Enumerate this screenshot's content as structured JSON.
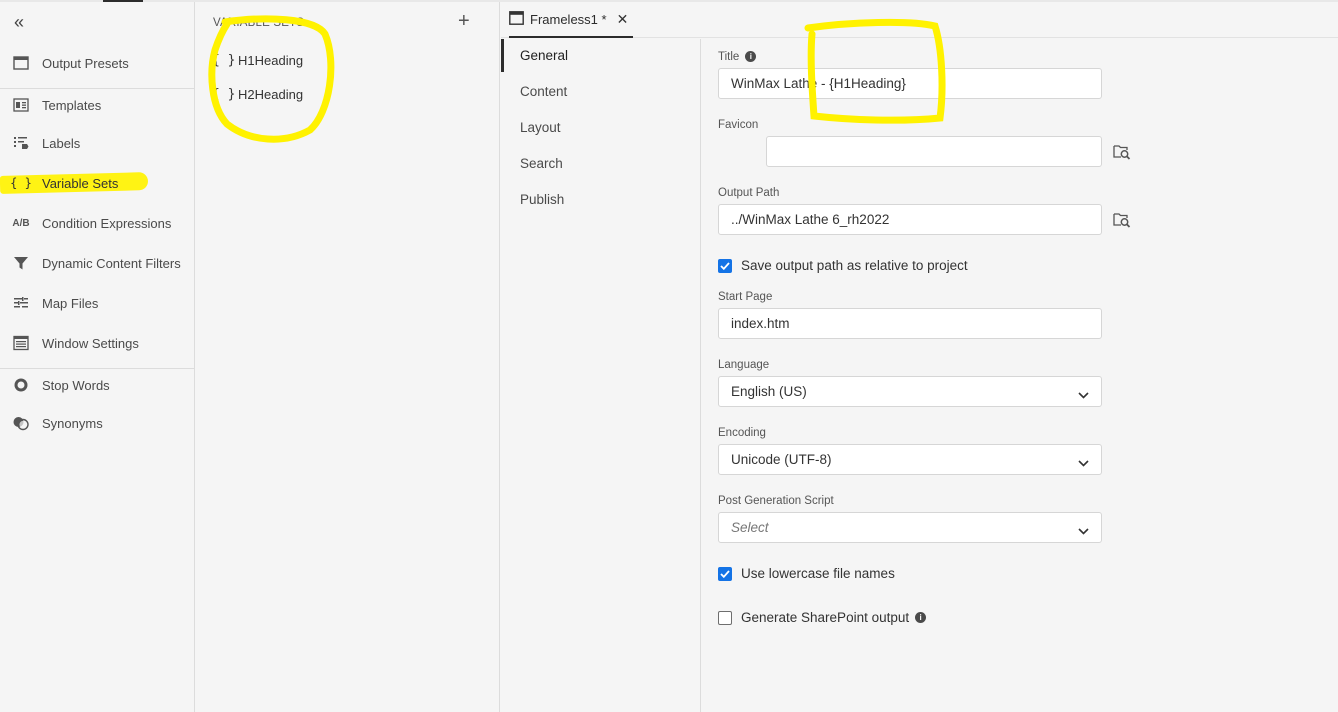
{
  "nav": {
    "collapse_label": "«",
    "items": [
      {
        "label": "Output Presets",
        "icon": "output-presets-icon"
      },
      {
        "label": "Templates",
        "icon": "templates-icon"
      },
      {
        "label": "Labels",
        "icon": "labels-icon"
      },
      {
        "label": "Variable Sets",
        "icon": "variable-sets-icon"
      },
      {
        "label": "Condition Expressions",
        "icon": "ab-icon",
        "icon_text": "A/B"
      },
      {
        "label": "Dynamic Content Filters",
        "icon": "filter-icon"
      },
      {
        "label": "Map Files",
        "icon": "map-files-icon"
      },
      {
        "label": "Window Settings",
        "icon": "window-settings-icon"
      },
      {
        "label": "Stop Words",
        "icon": "stop-words-icon"
      },
      {
        "label": "Synonyms",
        "icon": "synonyms-icon"
      }
    ],
    "selected": "Variable Sets"
  },
  "variable_sets": {
    "title": "VARIABLE SETS",
    "add_label": "+",
    "items": [
      {
        "brace": "{ }",
        "label": "H1Heading"
      },
      {
        "brace": "{ }",
        "label": "H2Heading"
      }
    ]
  },
  "doc_tab": {
    "name": "Frameless1 *",
    "close": "✕"
  },
  "subnav": {
    "items": [
      "General",
      "Content",
      "Layout",
      "Search",
      "Publish"
    ],
    "active": "General"
  },
  "form": {
    "title": {
      "label": "Title",
      "value": "WinMax Lathe - {H1Heading}"
    },
    "favicon": {
      "label": "Favicon",
      "value": ""
    },
    "output_path": {
      "label": "Output Path",
      "value": "../WinMax Lathe 6_rh2022"
    },
    "save_relative": {
      "label": "Save output path as relative to project",
      "checked": true
    },
    "start_page": {
      "label": "Start Page",
      "value": "index.htm"
    },
    "language": {
      "label": "Language",
      "value": "English (US)"
    },
    "encoding": {
      "label": "Encoding",
      "value": "Unicode (UTF-8)"
    },
    "post_script": {
      "label": "Post Generation Script",
      "placeholder": "Select"
    },
    "lowercase": {
      "label": "Use lowercase file names",
      "checked": true
    },
    "sharepoint": {
      "label": "Generate SharePoint output",
      "checked": false
    }
  },
  "colors": {
    "highlight": "#fff200",
    "checkbox_on": "#1473e6",
    "text": "#3a3a3a",
    "background": "#f5f5f5"
  }
}
